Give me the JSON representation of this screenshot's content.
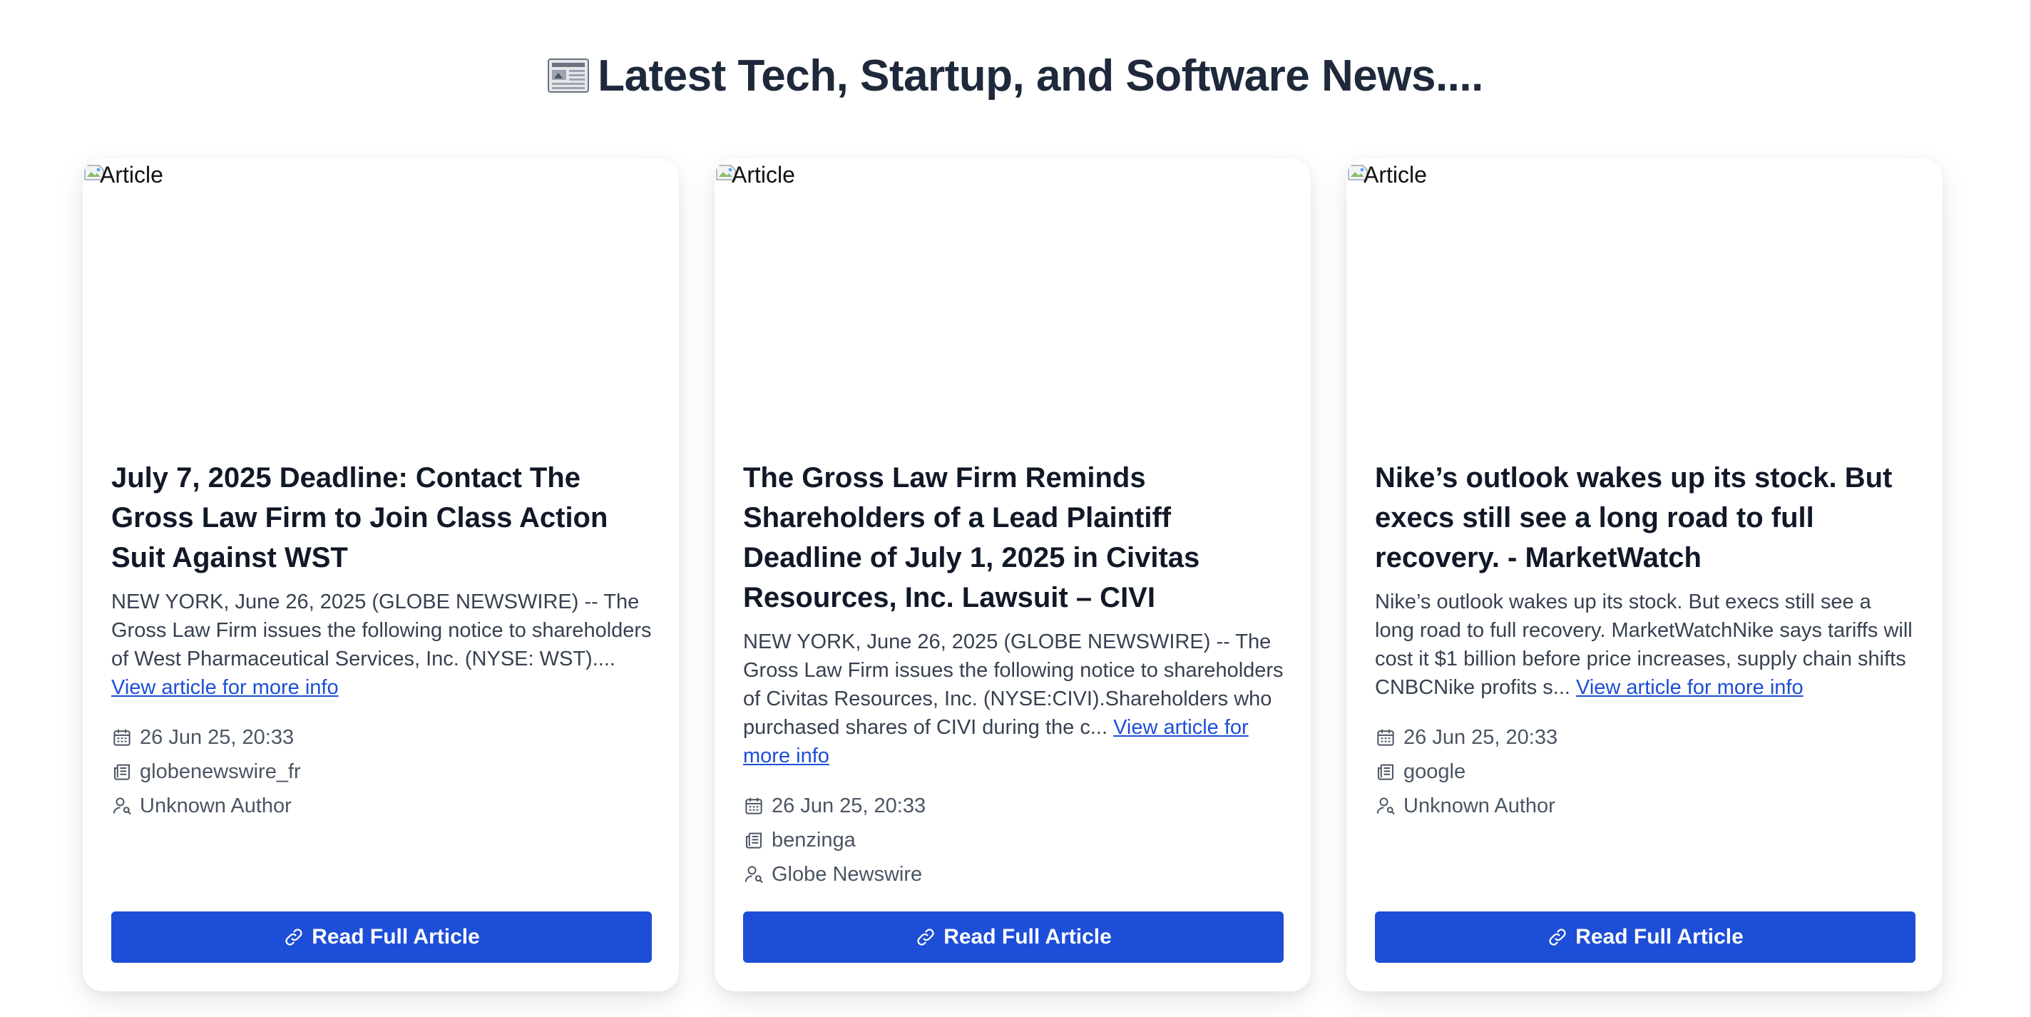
{
  "header": {
    "title": "Latest Tech, Startup, and Software News....",
    "icon": "newspaper-icon"
  },
  "articles": [
    {
      "image_alt": "Article",
      "title": "July 7, 2025 Deadline: Contact The Gross Law Firm to Join Class Action Suit Against WST",
      "description": "NEW YORK, June 26, 2025 (GLOBE NEWSWIRE) -- The Gross Law Firm issues the following notice to shareholders of West Pharmaceutical Services, Inc. (NYSE: WST)....",
      "more_link": "View article for more info",
      "date": "26 Jun 25, 20:33",
      "source": "globenewswire_fr",
      "author": "Unknown Author",
      "button_label": "Read Full Article"
    },
    {
      "image_alt": "Article",
      "title": "The Gross Law Firm Reminds Shareholders of a Lead Plaintiff Deadline of July 1, 2025 in Civitas Resources, Inc. Lawsuit – CIVI",
      "description": "NEW YORK, June 26, 2025 (GLOBE NEWSWIRE) -- The Gross Law Firm issues the following notice to shareholders of Civitas Resources, Inc. (NYSE:CIVI).Shareholders who purchased shares of CIVI during the c...",
      "more_link": "View article for more info",
      "date": "26 Jun 25, 20:33",
      "source": "benzinga",
      "author": "Globe Newswire",
      "button_label": "Read Full Article"
    },
    {
      "image_alt": "Article",
      "title": "Nike’s outlook wakes up its stock. But execs still see a long road to full recovery. - MarketWatch",
      "description": "Nike’s outlook wakes up its stock. But execs still see a long road to full recovery. MarketWatchNike says tariffs will cost it $1 billion before price increases, supply chain shifts CNBCNike profits s...",
      "more_link": "View article for more info",
      "date": "26 Jun 25, 20:33",
      "source": "google",
      "author": "Unknown Author",
      "button_label": "Read Full Article"
    }
  ],
  "colors": {
    "accent": "#1d4ed8",
    "title": "#1e293b",
    "text": "#374151"
  }
}
